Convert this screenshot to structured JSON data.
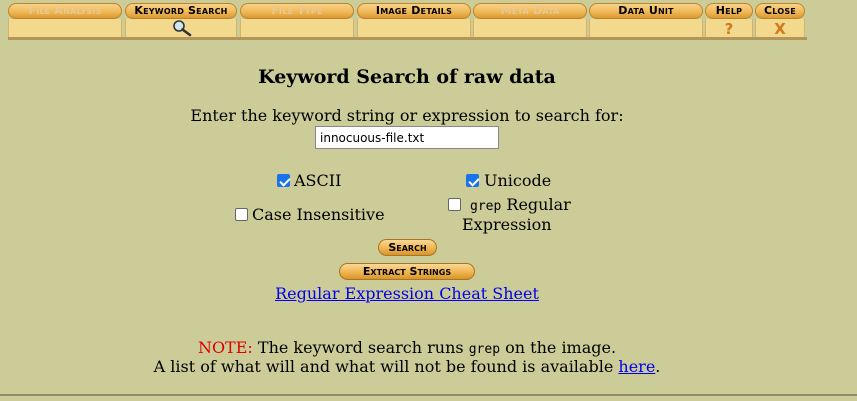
{
  "tabs": [
    {
      "label": "File Analysis",
      "state": "inactive"
    },
    {
      "label": "Keyword Search",
      "state": "active"
    },
    {
      "label": "File Type",
      "state": "inactive"
    },
    {
      "label": "Image Details",
      "state": "nav"
    },
    {
      "label": "Meta Data",
      "state": "inactive"
    },
    {
      "label": "Data Unit",
      "state": "nav"
    },
    {
      "label": "Help",
      "state": "nav"
    },
    {
      "label": "Close",
      "state": "nav"
    }
  ],
  "tab_glyphs": {
    "help": "?",
    "close": "X",
    "search_icon": "magnifier-icon"
  },
  "page": {
    "title": "Keyword Search of raw data",
    "prompt": "Enter the keyword string or expression to search for:",
    "keyword_value": "innocuous-file.txt"
  },
  "options": {
    "ascii": {
      "label": "ASCII",
      "checked": true
    },
    "unicode": {
      "label": "Unicode",
      "checked": true
    },
    "case_insensitive": {
      "label": "Case Insensitive",
      "checked": false
    },
    "grep_word": "grep",
    "regex_line1": "Regular",
    "regex_line2": "Expression",
    "regex_checked": false
  },
  "buttons": {
    "search": "Search",
    "extract": "Extract Strings"
  },
  "cheat_sheet_link": "Regular Expression Cheat Sheet",
  "note": {
    "label": "NOTE:",
    "text_pre": "The keyword search runs",
    "grep": "grep",
    "text_post": "on the image.",
    "line2_pre": "A list of what will and what will not be found is available",
    "link": "here",
    "line2_post": "."
  },
  "colors": {
    "background": "#cccc99",
    "tab_orange": "#f0b957",
    "note_red": "#e00000",
    "link_blue": "#0000ee",
    "checkbox_blue": "#1a73e8"
  }
}
